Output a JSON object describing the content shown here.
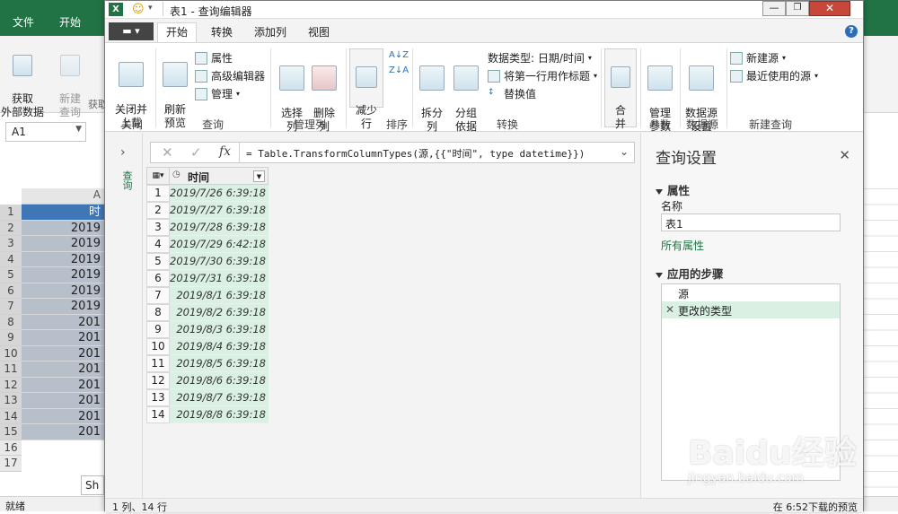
{
  "excel": {
    "tabs": [
      "文件",
      "开始"
    ],
    "ribbon": {
      "get_data_label": "获取\n外部数据",
      "new_query_label": "新建\n查询",
      "group_partial": "获取"
    },
    "name_box": "A1",
    "column_header": "A",
    "row_numbers": [
      "1",
      "2",
      "3",
      "4",
      "5",
      "6",
      "7",
      "8",
      "9",
      "10",
      "11",
      "12",
      "13",
      "14",
      "15",
      "16",
      "17"
    ],
    "cells": [
      "时",
      "2019",
      "2019",
      "2019",
      "2019",
      "2019",
      "2019",
      "201",
      "201",
      "201",
      "201",
      "201",
      "201",
      "201",
      "201"
    ],
    "sheet_tab": "Sh",
    "status": "就绪"
  },
  "pq": {
    "window_title": "表1 - 查询编辑器",
    "tabs": [
      "开始",
      "转换",
      "添加列",
      "视图"
    ],
    "active_tab": "开始",
    "ribbon": {
      "close_load": "关闭并\n上载",
      "refresh_preview": "刷新\n预览",
      "properties": "属性",
      "advanced_editor": "高级编辑器",
      "manage": "管理",
      "choose_columns": "选择\n列",
      "remove_columns": "删除\n列",
      "reduce_rows": "减少\n行",
      "sort_group": "排序",
      "split_column": "拆分\n列",
      "group_by": "分组\n依据",
      "data_type": "数据类型: 日期/时间",
      "use_first_row": "将第一行用作标题",
      "replace_values": "替换值",
      "combine": "合\n并",
      "manage_params": "管理\n参数",
      "datasource_settings": "数据源\n设置",
      "new_source": "新建源",
      "recent_sources": "最近使用的源",
      "groups": [
        "关闭",
        "查询",
        "管理列",
        "排序",
        "转换",
        "参数",
        "数据源",
        "新建查询"
      ]
    },
    "formula": "= Table.TransformColumnTypes(源,{{\"时间\", type datetime}})",
    "fx_label": "fx",
    "nav_label": "查询",
    "column_name": "时间",
    "rows": [
      "2019/7/26 6:39:18",
      "2019/7/27 6:39:18",
      "2019/7/28 6:39:18",
      "2019/7/29 6:42:18",
      "2019/7/30 6:39:18",
      "2019/7/31 6:39:18",
      "2019/8/1 6:39:18",
      "2019/8/2 6:39:18",
      "2019/8/3 6:39:18",
      "2019/8/4 6:39:18",
      "2019/8/5 6:39:18",
      "2019/8/6 6:39:18",
      "2019/8/7 6:39:18",
      "2019/8/8 6:39:18"
    ],
    "settings": {
      "title": "查询设置",
      "properties_header": "属性",
      "name_label": "名称",
      "name_value": "表1",
      "all_properties": "所有属性",
      "steps_header": "应用的步骤",
      "steps": [
        "源",
        "更改的类型"
      ]
    },
    "status_left": "1 列、14 行",
    "status_right": "在 6:52下载的预览"
  },
  "watermark": {
    "brand": "Baidu经验",
    "url": "jingyan.baidu.com"
  },
  "colors": {
    "excel_green": "#217346",
    "grid_green": "#d9f0e2",
    "accent": "#217346",
    "step_selected": "#d9f0e2"
  }
}
